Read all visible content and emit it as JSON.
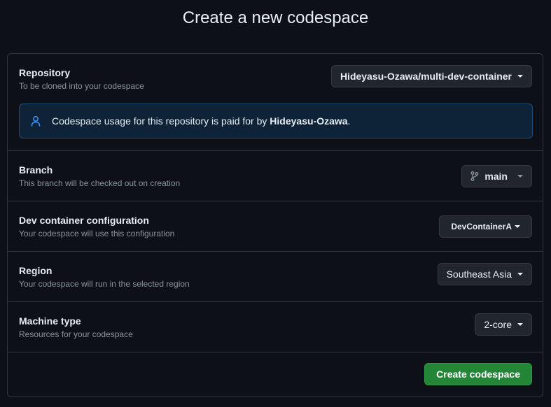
{
  "page_title": "Create a new codespace",
  "repository": {
    "label": "Repository",
    "description": "To be cloned into your codespace",
    "selected": "Hideyasu-Ozawa/multi-dev-container",
    "notice_prefix": "Codespace usage for this repository is paid for by ",
    "notice_owner": "Hideyasu-Ozawa",
    "notice_suffix": "."
  },
  "branch": {
    "label": "Branch",
    "description": "This branch will be checked out on creation",
    "selected": "main"
  },
  "dev_container": {
    "label": "Dev container configuration",
    "description": "Your codespace will use this configuration",
    "selected": "DevContainerA"
  },
  "region": {
    "label": "Region",
    "description": "Your codespace will run in the selected region",
    "selected": "Southeast Asia"
  },
  "machine_type": {
    "label": "Machine type",
    "description": "Resources for your codespace",
    "selected": "2-core"
  },
  "create_button_label": "Create codespace",
  "colors": {
    "background": "#0d1117",
    "border": "#30363d",
    "accent_blue": "#4493f8",
    "primary_green": "#238636"
  },
  "icons": {
    "notice": "person-icon",
    "branch": "git-branch-icon",
    "dropdown": "caret-down-icon"
  }
}
